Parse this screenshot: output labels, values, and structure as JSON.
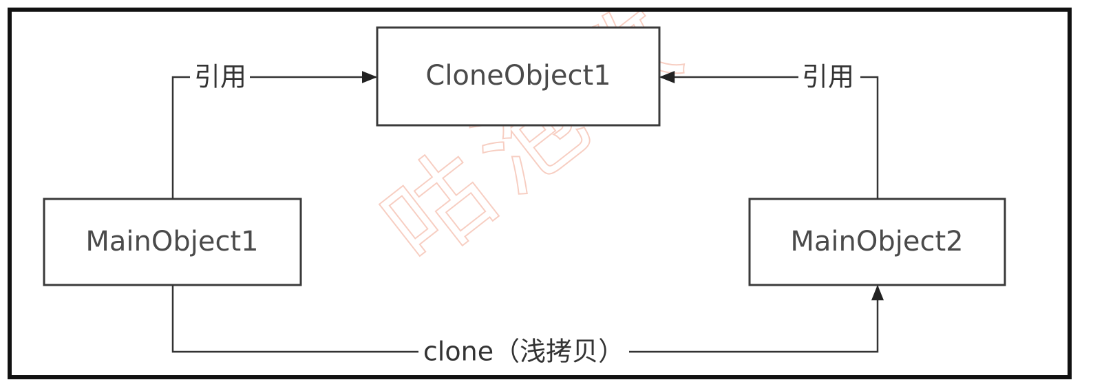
{
  "nodes": {
    "clone_object_1": "CloneObject1",
    "main_object_1": "MainObject1",
    "main_object_2": "MainObject2"
  },
  "edges": {
    "ref_left": "引用",
    "ref_right": "引用",
    "clone": "clone（浅拷贝）"
  },
  "watermark": {
    "chars": [
      "咕",
      "泡",
      "教"
    ]
  },
  "colors": {
    "frame": "#111111",
    "box_border": "#3a3a3a",
    "edge": "#333333",
    "arrowhead": "#222222",
    "watermark": "#f6c6b8"
  }
}
